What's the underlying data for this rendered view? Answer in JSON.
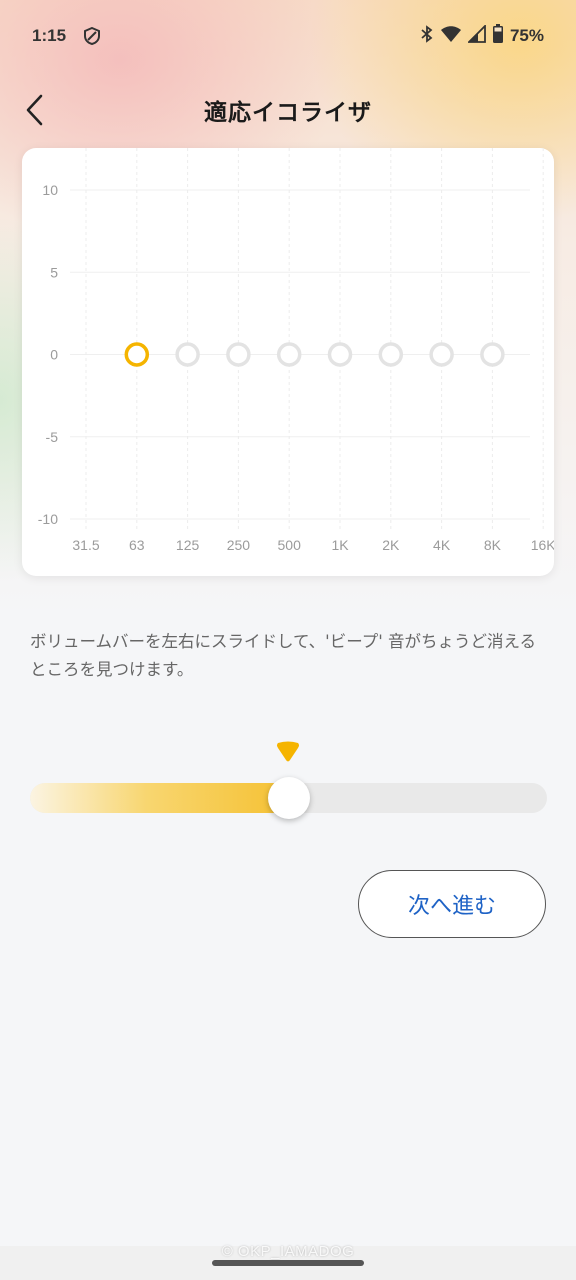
{
  "status_bar": {
    "time": "1:15",
    "battery": "75%",
    "icons": [
      "shield-icon",
      "bluetooth-icon",
      "wifi-icon",
      "signal-icon",
      "battery-icon"
    ]
  },
  "header": {
    "title": "適応イコライザ",
    "back_icon": "chevron-left-icon"
  },
  "chart_data": {
    "type": "scatter",
    "x_labels": [
      "31.5",
      "63",
      "125",
      "250",
      "500",
      "1K",
      "2K",
      "4K",
      "8K",
      "16K"
    ],
    "y_ticks": [
      "10",
      "5",
      "0",
      "-5",
      "-10"
    ],
    "ylim": [
      -10,
      10
    ],
    "points": [
      {
        "x": "63",
        "y": 0,
        "state": "active"
      },
      {
        "x": "125",
        "y": 0,
        "state": "pending"
      },
      {
        "x": "250",
        "y": 0,
        "state": "pending"
      },
      {
        "x": "500",
        "y": 0,
        "state": "pending"
      },
      {
        "x": "1K",
        "y": 0,
        "state": "pending"
      },
      {
        "x": "2K",
        "y": 0,
        "state": "pending"
      },
      {
        "x": "4K",
        "y": 0,
        "state": "pending"
      },
      {
        "x": "8K",
        "y": 0,
        "state": "pending"
      }
    ],
    "colors": {
      "active": "#f5b400",
      "pending": "#e3e3e3"
    },
    "grid": true
  },
  "instruction": "ボリュームバーを左右にスライドして、'ビープ' 音がちょうど消えるところを見つけます。",
  "slider": {
    "value_fraction": 0.5,
    "marker_color": "#f5b400"
  },
  "next_button": {
    "label": "次へ進む"
  },
  "watermark": "© OKP_IAMADOG"
}
